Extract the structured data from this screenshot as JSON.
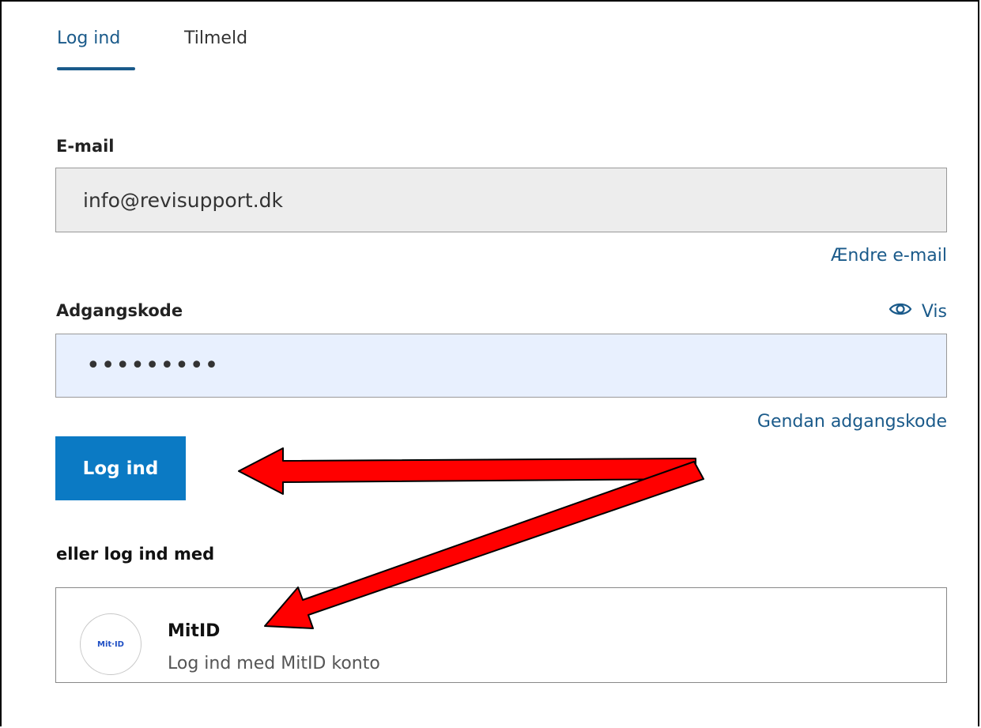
{
  "tabs": [
    {
      "label": "Log ind",
      "active": true
    },
    {
      "label": "Tilmeld",
      "active": false
    }
  ],
  "email": {
    "label": "E-mail",
    "value": "info@revisupport.dk",
    "change_link": "Ændre e-mail"
  },
  "password": {
    "label": "Adgangskode",
    "show_label": "Vis",
    "show_icon": "eye-icon",
    "masked_value": "•••••••••",
    "recover_link": "Gendan adgangskode"
  },
  "login_button": "Log ind",
  "alt_login": {
    "heading": "eller log ind med",
    "provider": {
      "logo_text": "Mit∙ID",
      "name": "MitID",
      "description": "Log ind med MitID konto"
    }
  },
  "colors": {
    "accent": "#1a5a8a",
    "button": "#0b7ac4",
    "annotation_arrow": "#ff0000"
  }
}
